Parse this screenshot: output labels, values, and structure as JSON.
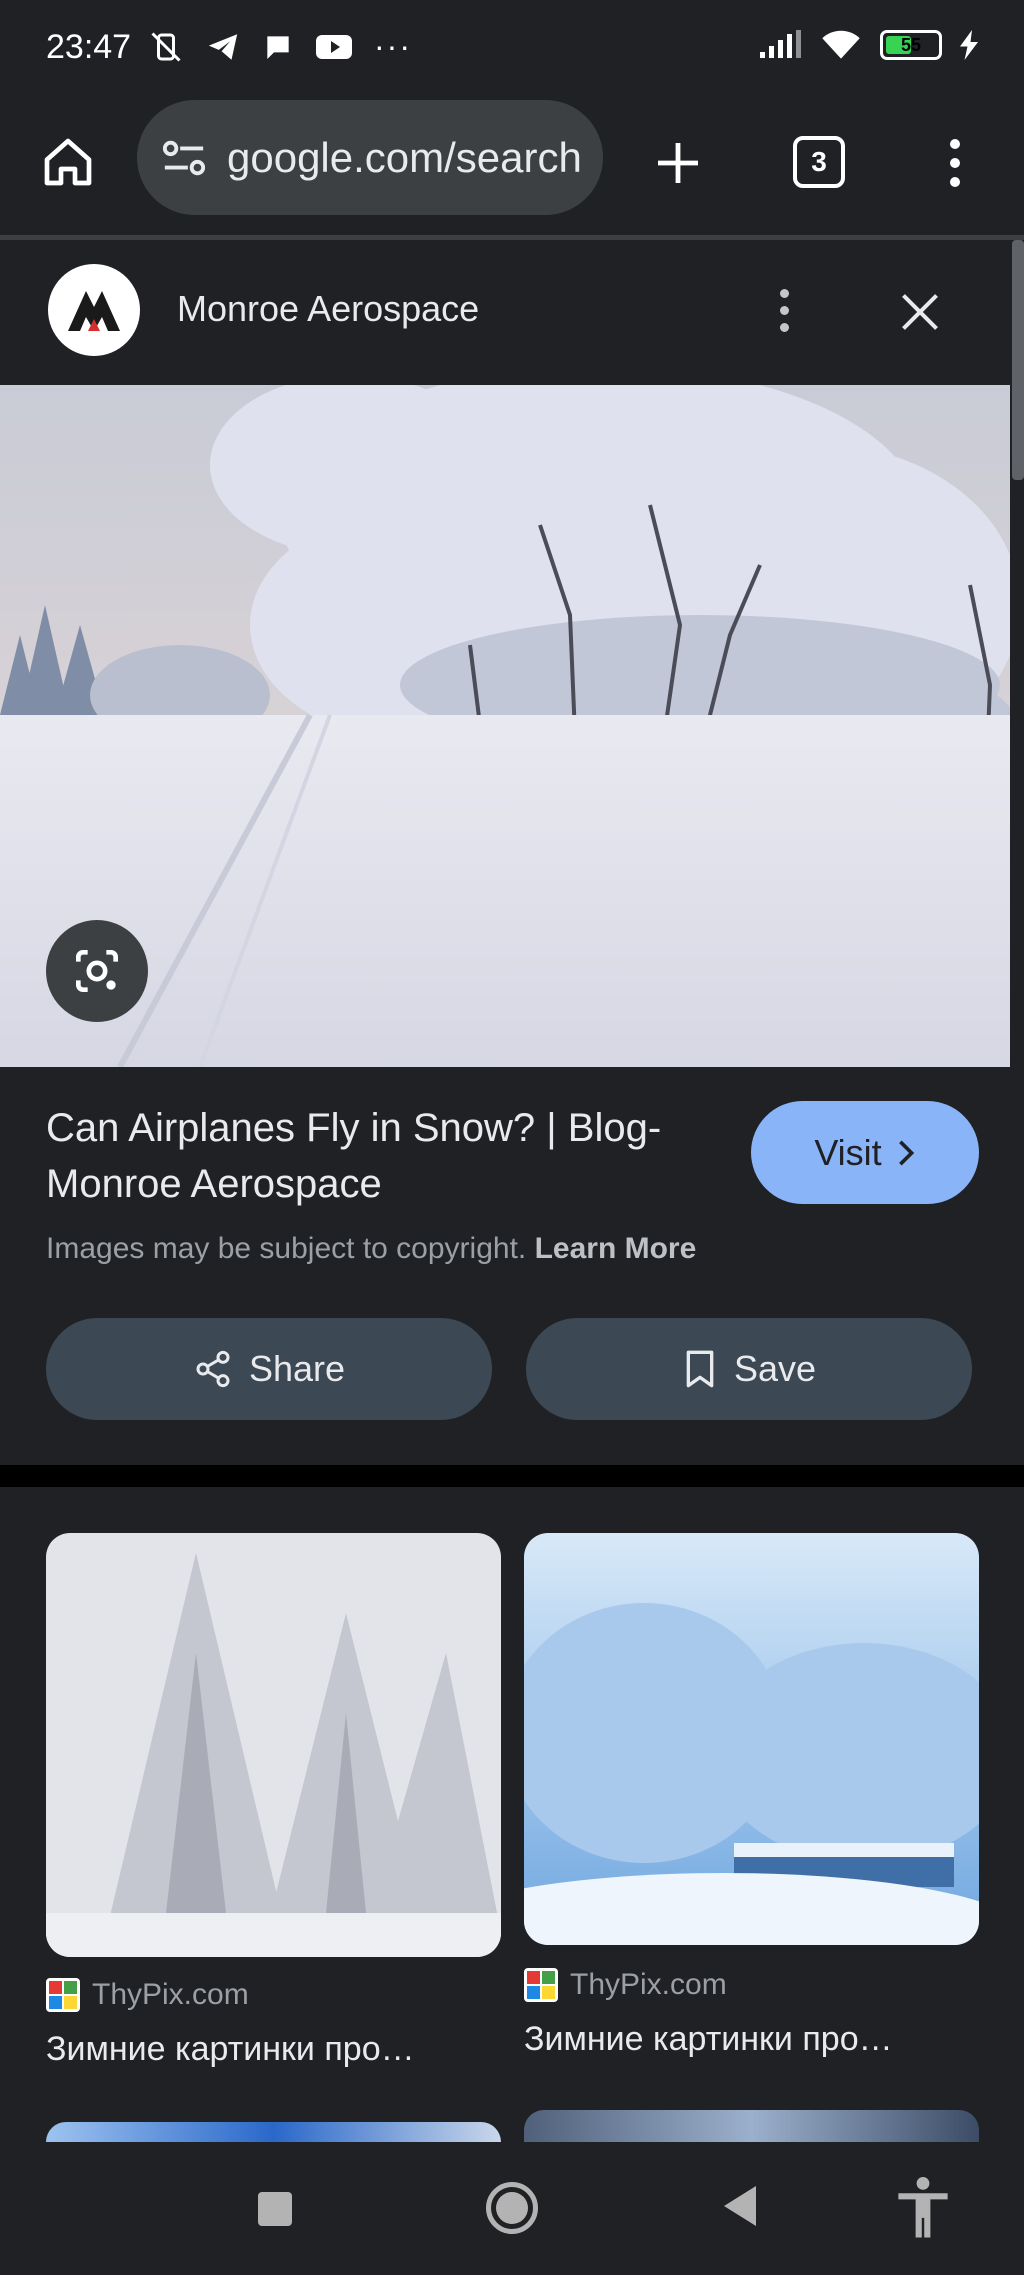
{
  "status_bar": {
    "time": "23:47",
    "battery_level": "55",
    "battery_fraction": 0.55,
    "icons": [
      "vibrate-off-icon",
      "telegram-icon",
      "chat-bubble-icon",
      "youtube-icon",
      "more-icon",
      "signal-icon",
      "wifi-icon",
      "battery-icon",
      "charging-icon"
    ]
  },
  "toolbar": {
    "url": "google.com/search",
    "tab_count": "3",
    "icons": [
      "home-icon",
      "site-settings-icon",
      "new-tab-icon",
      "tab-switcher-icon",
      "menu-icon"
    ]
  },
  "source": {
    "name": "Monroe Aerospace",
    "icons": [
      "more-vert-icon",
      "close-icon"
    ]
  },
  "result": {
    "title": "Can Airplanes Fly in Snow? | Blog- Monroe Aerospace",
    "visit_label": "Visit",
    "copyright_text": "Images may be subject to copyright.",
    "learn_more": "Learn More",
    "share_label": "Share",
    "save_label": "Save"
  },
  "related": [
    {
      "site": "ThyPix.com",
      "caption": "Зимние картинки про…"
    },
    {
      "site": "ThyPix.com",
      "caption": "Зимние картинки про…"
    }
  ],
  "colors": {
    "background": "#202124",
    "accent": "#8ab4f8",
    "button": "#3c4853"
  }
}
